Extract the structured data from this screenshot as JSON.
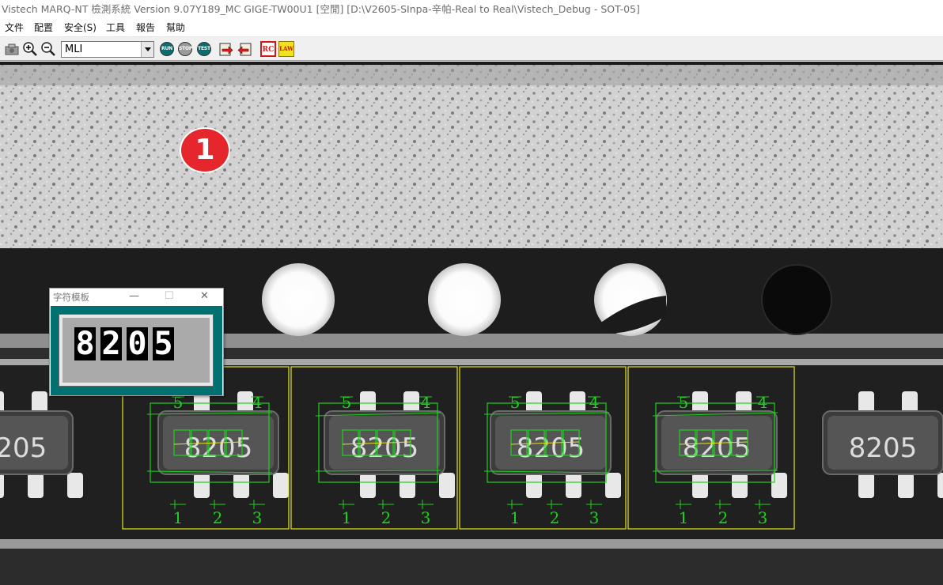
{
  "window": {
    "title": "Vistech MARQ-NT 檢測系統 Version 9.07Y189_MC GIGE-TW00U1 [空閒] [D:\\V2605-SInpa-辛帕-Real to Real\\Vistech_Debug - SOT-05]"
  },
  "menu": {
    "items": [
      "文件",
      "配置",
      "安全(S)",
      "工具",
      "報告",
      "幫助"
    ]
  },
  "toolbar": {
    "model_select_value": "MLI",
    "run_label": "RUN",
    "stop_label": "STOP",
    "test_label": "TEST",
    "rc_label": "RC",
    "law_label": "LAW",
    "icons": [
      "camera-icon",
      "zoom-in-icon",
      "zoom-out-icon",
      "run-icon",
      "stop-icon",
      "test-icon",
      "export-icon",
      "import-icon",
      "rc-icon",
      "law-icon"
    ]
  },
  "annotation": {
    "step_number": "1",
    "color": "#e5262d"
  },
  "char_template_window": {
    "title": "字符模板",
    "minimize": "—",
    "maximize": "☐",
    "close": "✕",
    "chars": [
      "8",
      "2",
      "0",
      "5"
    ]
  },
  "inspection": {
    "component_marking": "8205",
    "pin_labels_top": [
      "5",
      "4"
    ],
    "pin_labels_bottom": [
      "1",
      "2",
      "3"
    ],
    "roi_color": "#e6e61e",
    "detection_color": "#1ed21e"
  }
}
